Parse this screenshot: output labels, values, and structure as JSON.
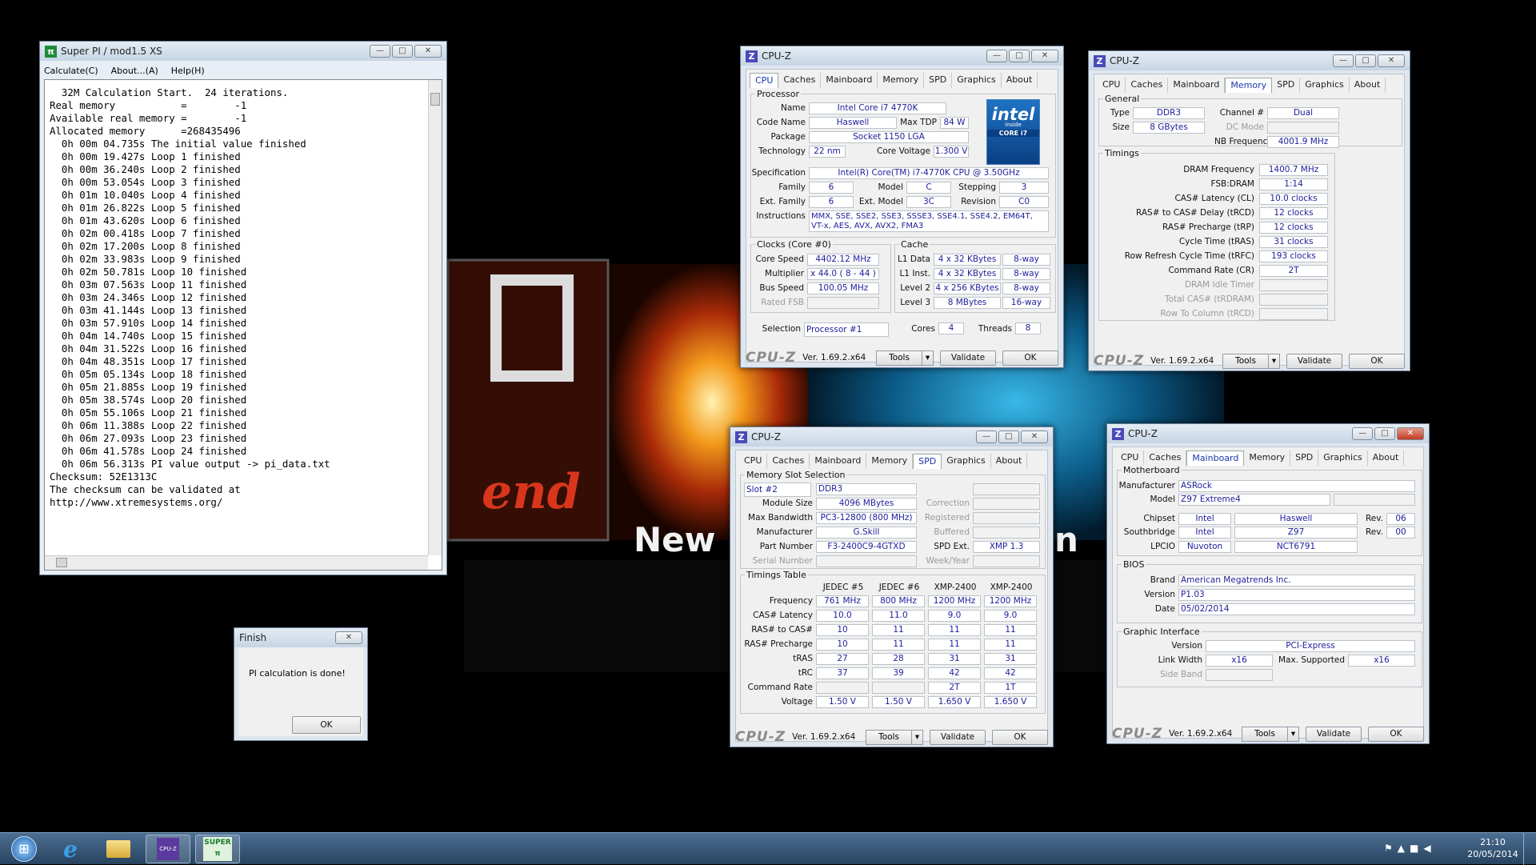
{
  "wallpaper": {
    "text_end": "end",
    "text_new": "New H",
    "text_on": "n"
  },
  "superpi": {
    "title": "Super PI / mod1.5 XS",
    "menu": [
      "Calculate(C)",
      "About...(A)",
      "Help(H)"
    ],
    "lines": [
      "  32M Calculation Start.  24 iterations.",
      "Real memory           =        -1",
      "Available real memory =        -1",
      "Allocated memory      =268435496",
      "  0h 00m 04.735s The initial value finished",
      "  0h 00m 19.427s Loop 1 finished",
      "  0h 00m 36.240s Loop 2 finished",
      "  0h 00m 53.054s Loop 3 finished",
      "  0h 01m 10.040s Loop 4 finished",
      "  0h 01m 26.822s Loop 5 finished",
      "  0h 01m 43.620s Loop 6 finished",
      "  0h 02m 00.418s Loop 7 finished",
      "  0h 02m 17.200s Loop 8 finished",
      "  0h 02m 33.983s Loop 9 finished",
      "  0h 02m 50.781s Loop 10 finished",
      "  0h 03m 07.563s Loop 11 finished",
      "  0h 03m 24.346s Loop 12 finished",
      "  0h 03m 41.144s Loop 13 finished",
      "  0h 03m 57.910s Loop 14 finished",
      "  0h 04m 14.740s Loop 15 finished",
      "  0h 04m 31.522s Loop 16 finished",
      "  0h 04m 48.351s Loop 17 finished",
      "  0h 05m 05.134s Loop 18 finished",
      "  0h 05m 21.885s Loop 19 finished",
      "  0h 05m 38.574s Loop 20 finished",
      "  0h 05m 55.106s Loop 21 finished",
      "  0h 06m 11.388s Loop 22 finished",
      "  0h 06m 27.093s Loop 23 finished",
      "  0h 06m 41.578s Loop 24 finished",
      "  0h 06m 56.313s PI value output -> pi_data.txt",
      "",
      "Checksum: 52E1313C",
      "The checksum can be validated at",
      "http://www.xtremesystems.org/"
    ]
  },
  "finish": {
    "title": "Finish",
    "message": "PI calculation is done!",
    "ok": "OK"
  },
  "cpuz": {
    "title": "CPU-Z",
    "logo": "CPU-Z",
    "version": "Ver. 1.69.2.x64",
    "tools": "Tools",
    "validate": "Validate",
    "ok": "OK",
    "tabs": [
      "CPU",
      "Caches",
      "Mainboard",
      "Memory",
      "SPD",
      "Graphics",
      "About"
    ]
  },
  "cpu": {
    "processor_group": "Processor",
    "name_label": "Name",
    "name": "Intel Core i7 4770K",
    "codename_label": "Code Name",
    "codename": "Haswell",
    "maxtdp_label": "Max TDP",
    "maxtdp": "84 W",
    "package_label": "Package",
    "package": "Socket 1150 LGA",
    "tech_label": "Technology",
    "tech": "22 nm",
    "voltage_label": "Core Voltage",
    "voltage": "1.300 V",
    "spec_label": "Specification",
    "spec": "Intel(R) Core(TM) i7-4770K CPU @ 3.50GHz",
    "family_label": "Family",
    "family": "6",
    "model_label": "Model",
    "model": "C",
    "stepping_label": "Stepping",
    "stepping": "3",
    "extfamily_label": "Ext. Family",
    "extfamily": "6",
    "extmodel_label": "Ext. Model",
    "extmodel": "3C",
    "revision_label": "Revision",
    "revision": "C0",
    "instr_label": "Instructions",
    "instr": "MMX, SSE, SSE2, SSE3, SSSE3, SSE4.1, SSE4.2, EM64T, VT-x, AES, AVX, AVX2, FMA3",
    "clocks_group": "Clocks (Core #0)",
    "corespeed_label": "Core Speed",
    "corespeed": "4402.12 MHz",
    "mult_label": "Multiplier",
    "mult": "x 44.0 ( 8 - 44 )",
    "bus_label": "Bus Speed",
    "bus": "100.05 MHz",
    "fsb_label": "Rated FSB",
    "cache_group": "Cache",
    "l1d_label": "L1 Data",
    "l1d": "4 x 32 KBytes",
    "l1d_way": "8-way",
    "l1i_label": "L1 Inst.",
    "l1i": "4 x 32 KBytes",
    "l1i_way": "8-way",
    "l2_label": "Level 2",
    "l2": "4 x 256 KBytes",
    "l2_way": "8-way",
    "l3_label": "Level 3",
    "l3": "8 MBytes",
    "l3_way": "16-way",
    "selection_label": "Selection",
    "selection": "Processor #1",
    "cores_label": "Cores",
    "cores": "4",
    "threads_label": "Threads",
    "threads": "8",
    "logo_brand": "intel",
    "logo_inside": "inside",
    "logo_core": "CORE i7"
  },
  "mem": {
    "general_group": "General",
    "type_label": "Type",
    "type": "DDR3",
    "channel_label": "Channel #",
    "channel": "Dual",
    "size_label": "Size",
    "size": "8 GBytes",
    "dcmode_label": "DC Mode",
    "nbfreq_label": "NB Frequency",
    "nbfreq": "4001.9 MHz",
    "timings_group": "Timings",
    "timings": [
      {
        "label": "DRAM Frequency",
        "value": "1400.7 MHz"
      },
      {
        "label": "FSB:DRAM",
        "value": "1:14"
      },
      {
        "label": "CAS# Latency (CL)",
        "value": "10.0 clocks"
      },
      {
        "label": "RAS# to CAS# Delay (tRCD)",
        "value": "12 clocks"
      },
      {
        "label": "RAS# Precharge (tRP)",
        "value": "12 clocks"
      },
      {
        "label": "Cycle Time (tRAS)",
        "value": "31 clocks"
      },
      {
        "label": "Row Refresh Cycle Time (tRFC)",
        "value": "193 clocks"
      },
      {
        "label": "Command Rate (CR)",
        "value": "2T"
      },
      {
        "label": "DRAM Idle Timer",
        "value": ""
      },
      {
        "label": "Total CAS# (tRDRAM)",
        "value": ""
      },
      {
        "label": "Row To Column (tRCD)",
        "value": ""
      }
    ]
  },
  "spd": {
    "slot_group": "Memory Slot Selection",
    "slot": "Slot #2",
    "slot_type": "DDR3",
    "modsize_label": "Module Size",
    "modsize": "4096 MBytes",
    "maxbw_label": "Max Bandwidth",
    "maxbw": "PC3-12800 (800 MHz)",
    "manuf_label": "Manufacturer",
    "manuf": "G.Skill",
    "part_label": "Part Number",
    "part": "F3-2400C9-4GTXD",
    "serial_label": "Serial Number",
    "correction_label": "Correction",
    "registered_label": "Registered",
    "buffered_label": "Buffered",
    "spdext_label": "SPD Ext.",
    "spdext": "XMP 1.3",
    "weekyear_label": "Week/Year",
    "timings_group": "Timings Table",
    "cols": [
      "JEDEC #5",
      "JEDEC #6",
      "XMP-2400",
      "XMP-2400"
    ],
    "rows": [
      {
        "label": "Frequency",
        "values": [
          "761 MHz",
          "800 MHz",
          "1200 MHz",
          "1200 MHz"
        ]
      },
      {
        "label": "CAS# Latency",
        "values": [
          "10.0",
          "11.0",
          "9.0",
          "9.0"
        ]
      },
      {
        "label": "RAS# to CAS#",
        "values": [
          "10",
          "11",
          "11",
          "11"
        ]
      },
      {
        "label": "RAS# Precharge",
        "values": [
          "10",
          "11",
          "11",
          "11"
        ]
      },
      {
        "label": "tRAS",
        "values": [
          "27",
          "28",
          "31",
          "31"
        ]
      },
      {
        "label": "tRC",
        "values": [
          "37",
          "39",
          "42",
          "42"
        ]
      },
      {
        "label": "Command Rate",
        "values": [
          "",
          "",
          "2T",
          "1T"
        ]
      },
      {
        "label": "Voltage",
        "values": [
          "1.50 V",
          "1.50 V",
          "1.650 V",
          "1.650 V"
        ]
      }
    ]
  },
  "mb": {
    "mobo_group": "Motherboard",
    "manuf_label": "Manufacturer",
    "manuf": "ASRock",
    "model_label": "Model",
    "model": "Z97 Extreme4",
    "chipset_label": "Chipset",
    "chipset_vendor": "Intel",
    "chipset": "Haswell",
    "chipset_rev": "06",
    "rev_label": "Rev.",
    "sb_label": "Southbridge",
    "sb_vendor": "Intel",
    "sb": "Z97",
    "sb_rev": "00",
    "lpcio_label": "LPCIO",
    "lpcio_vendor": "Nuvoton",
    "lpcio": "NCT6791",
    "bios_group": "BIOS",
    "brand_label": "Brand",
    "brand": "American Megatrends Inc.",
    "version_label": "Version",
    "version": "P1.03",
    "date_label": "Date",
    "date": "05/02/2014",
    "gi_group": "Graphic Interface",
    "giver_label": "Version",
    "giver": "PCI-Express",
    "lw_label": "Link Width",
    "lw": "x16",
    "maxsup_label": "Max. Supported",
    "maxsup": "x16",
    "sideband_label": "Side Band"
  },
  "taskbar": {
    "time": "21:10",
    "date": "20/05/2014",
    "superpi_icon_text": "SUPER",
    "cpuz_icon_text": "CPU-Z"
  },
  "colors": {
    "accent": "#1a37a8",
    "value_text": "#1d1d9c",
    "taskbar": "#3a5878"
  }
}
